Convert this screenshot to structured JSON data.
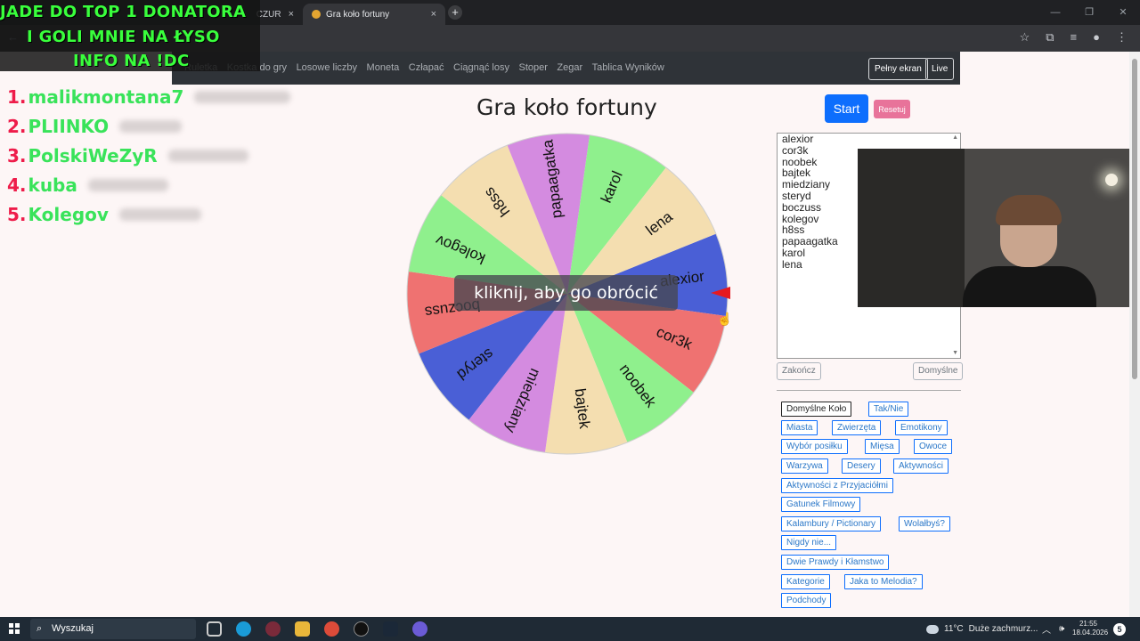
{
  "browser": {
    "inactive_tab_label": "CZUR",
    "active_tab_label": "Gra koło fortuny",
    "tab_close": "×",
    "new_tab": "+"
  },
  "stream_overlay": {
    "line1": "JADE DO TOP 1 DONATORA",
    "line2": "I GOLI MNIE NA ŁYSO",
    "line3": "INFO NA !DC",
    "top_donators": [
      {
        "rank": "1.",
        "name": "malikmontana7"
      },
      {
        "rank": "2.",
        "name": "PLIINKO"
      },
      {
        "rank": "3.",
        "name": "PolskiWeZyR"
      },
      {
        "rank": "4.",
        "name": "kuba"
      },
      {
        "rank": "5.",
        "name": "Kolegov"
      }
    ]
  },
  "nav": {
    "items": [
      "Ruletka",
      "Kostka do gry",
      "Losowe liczby",
      "Moneta",
      "Człapać",
      "Ciągnąć losy",
      "Stoper",
      "Zegar",
      "Tablica Wyników"
    ],
    "fullscreen_button": "Pełny ekran",
    "live_button": "Live"
  },
  "main": {
    "title": "Gra koło fortuny",
    "tooltip": "kliknij, aby go obrócić",
    "start_button": "Start",
    "reset_button": "Resetuj",
    "end_button": "Zakończ",
    "default_button": "Domyślne"
  },
  "wheel": {
    "segments": [
      {
        "label": "alexior",
        "color": "#4a5fd6"
      },
      {
        "label": "cor3k",
        "color": "#ef7271"
      },
      {
        "label": "noobek",
        "color": "#8ff08d"
      },
      {
        "label": "bajtek",
        "color": "#f4deb0"
      },
      {
        "label": "miedziany",
        "color": "#d48be0"
      },
      {
        "label": "steryd",
        "color": "#4a5fd6"
      },
      {
        "label": "boczuss",
        "color": "#ef7271"
      },
      {
        "label": "kolegov",
        "color": "#8ff08d"
      },
      {
        "label": "h8ss",
        "color": "#f4deb0"
      },
      {
        "label": "papaagatka",
        "color": "#d48be0"
      },
      {
        "label": "karol",
        "color": "#8ff08d"
      },
      {
        "label": "lena",
        "color": "#f4deb0"
      }
    ],
    "pointer_color": "#e6191f"
  },
  "names_list": [
    "alexior",
    "cor3k",
    "noobek",
    "bajtek",
    "miedziany",
    "steryd",
    "boczuss",
    "kolegov",
    "h8ss",
    "papaagatka",
    "karol",
    "lena"
  ],
  "presets": [
    "Domyślne Koło",
    "Tak/Nie",
    "Miasta",
    "Zwierzęta",
    "Emotikony",
    "Wybór posiłku",
    "Mięsa",
    "Owoce",
    "Warzywa",
    "Desery",
    "Aktywności",
    "Aktywności z Przyjaciółmi",
    "Gatunek Filmowy",
    "Kalambury / Pictionary",
    "Wolałbyś?",
    "Nigdy nie...",
    "Dwie Prawdy i Kłamstwo",
    "Kategorie",
    "Jaka to Melodia?",
    "Podchody"
  ],
  "taskbar": {
    "search_placeholder": "Wyszukaj",
    "weather_temp": "11°C",
    "weather_desc": "Duże zachmurz...",
    "time": "21:55",
    "date": "18.04.2026",
    "notifications": "5"
  }
}
